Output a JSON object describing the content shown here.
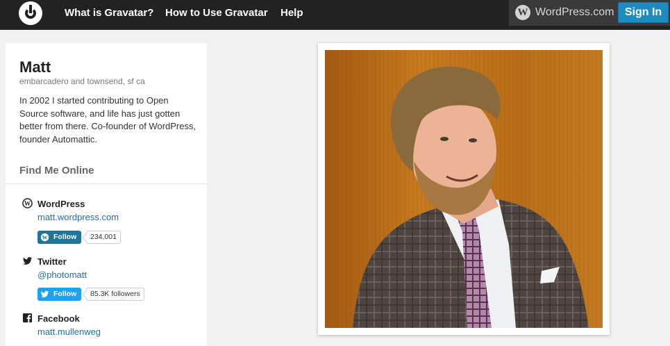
{
  "header": {
    "logo": "gravatar-logo",
    "nav": [
      {
        "label": "What is Gravatar?"
      },
      {
        "label": "How to Use Gravatar"
      },
      {
        "label": "Help"
      }
    ],
    "wordpress_label": "WordPress.com",
    "signin_label": "Sign In"
  },
  "profile": {
    "name": "Matt",
    "location": "embarcadero and townsend, sf ca",
    "bio": "In 2002 I started contributing to Open Source software, and life has just gotten better from there. Co-founder of WordPress, founder Automattic.",
    "find_me_title": "Find Me Online",
    "accounts": [
      {
        "name": "WordPress",
        "link": "matt.wordpress.com",
        "icon": "wordpress-icon",
        "follow_label": "Follow",
        "count": "234,001"
      },
      {
        "name": "Twitter",
        "link": "@photomatt",
        "icon": "twitter-icon",
        "follow_label": "Follow",
        "count": "85.3K followers"
      },
      {
        "name": "Facebook",
        "link": "matt.mullenweg",
        "icon": "facebook-icon"
      }
    ]
  },
  "photo": {
    "description": "profile-photo"
  },
  "colors": {
    "header_bg": "#222222",
    "accent": "#1e8cbe",
    "link": "#1e6fa8",
    "twitter": "#1da1f2",
    "wordpress_btn": "#21759b"
  }
}
